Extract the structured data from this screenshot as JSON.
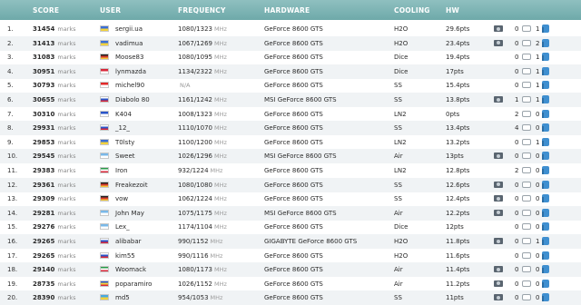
{
  "header": {
    "score": "SCORE",
    "user": "USER",
    "frequency": "FREQUENCY",
    "hardware": "HARDWARE",
    "cooling": "COOLING",
    "hw": "HW"
  },
  "rows": [
    {
      "rank": "1.",
      "score": "31454",
      "marks": "marks",
      "flag": [
        "#3b6fd6",
        "#f2d23c"
      ],
      "user": "sergii.ua",
      "freq": "1080/1323",
      "mhz": "MHz",
      "hardware": "GeForce 8600 GTS",
      "cooling": "H2O",
      "pts": "29.6pts",
      "cam": true,
      "comments": "0",
      "likes": "1"
    },
    {
      "rank": "2.",
      "score": "31413",
      "marks": "marks",
      "flag": [
        "#3b6fd6",
        "#f2d23c"
      ],
      "user": "vadimua",
      "freq": "1067/1269",
      "mhz": "MHz",
      "hardware": "GeForce 8600 GTS",
      "cooling": "H2O",
      "pts": "23.4pts",
      "cam": true,
      "comments": "0",
      "likes": "2"
    },
    {
      "rank": "3.",
      "score": "31083",
      "marks": "marks",
      "flag": [
        "#222222",
        "#d83a2c",
        "#f2c73c"
      ],
      "user": "Moose83",
      "freq": "1080/1095",
      "mhz": "MHz",
      "hardware": "GeForce 8600 GTS",
      "cooling": "Dice",
      "pts": "19.4pts",
      "cam": false,
      "comments": "0",
      "likes": "1"
    },
    {
      "rank": "4.",
      "score": "30951",
      "marks": "marks",
      "flag": [
        "#d8283a",
        "#ffffff"
      ],
      "user": "lynmazda",
      "freq": "1134/2322",
      "mhz": "MHz",
      "hardware": "GeForce 8600 GTS",
      "cooling": "Dice",
      "pts": "17pts",
      "cam": false,
      "comments": "0",
      "likes": "1"
    },
    {
      "rank": "5.",
      "score": "30793",
      "marks": "marks",
      "flag": [
        "#e02a2a",
        "#ffffff"
      ],
      "user": "michel90",
      "freq": "",
      "mhz": "N/A",
      "hardware": "GeForce 8600 GTS",
      "cooling": "SS",
      "pts": "15.4pts",
      "cam": false,
      "comments": "0",
      "likes": "1"
    },
    {
      "rank": "6.",
      "score": "30655",
      "marks": "marks",
      "flag": [
        "#ffffff",
        "#2a55c8",
        "#d8283a"
      ],
      "user": "Diabolo 80",
      "freq": "1161/1242",
      "mhz": "MHz",
      "hardware": "MSI GeForce 8600 GTS",
      "cooling": "SS",
      "pts": "13.8pts",
      "cam": true,
      "comments": "1",
      "likes": "1"
    },
    {
      "rank": "7.",
      "score": "30310",
      "marks": "marks",
      "flag": [
        "#2a55c8",
        "#ffffff"
      ],
      "user": "K404",
      "freq": "1008/1323",
      "mhz": "MHz",
      "hardware": "GeForce 8600 GTS",
      "cooling": "LN2",
      "pts": "0pts",
      "cam": false,
      "comments": "2",
      "likes": "0"
    },
    {
      "rank": "8.",
      "score": "29931",
      "marks": "marks",
      "flag": [
        "#ffffff",
        "#2a55c8",
        "#d8283a"
      ],
      "user": "_12_",
      "freq": "1110/1070",
      "mhz": "MHz",
      "hardware": "GeForce 8600 GTS",
      "cooling": "SS",
      "pts": "13.4pts",
      "cam": false,
      "comments": "4",
      "likes": "0"
    },
    {
      "rank": "9.",
      "score": "29853",
      "marks": "marks",
      "flag": [
        "#3b6fd6",
        "#f2d23c"
      ],
      "user": "T0lsty",
      "freq": "1100/1200",
      "mhz": "MHz",
      "hardware": "GeForce 8600 GTS",
      "cooling": "LN2",
      "pts": "13.2pts",
      "cam": false,
      "comments": "0",
      "likes": "1"
    },
    {
      "rank": "10.",
      "score": "29545",
      "marks": "marks",
      "flag": [
        "#7ab8e8",
        "#ffffff"
      ],
      "user": "Sweet",
      "freq": "1026/1296",
      "mhz": "MHz",
      "hardware": "MSI GeForce 8600 GTS",
      "cooling": "Air",
      "pts": "13pts",
      "cam": true,
      "comments": "0",
      "likes": "0"
    },
    {
      "rank": "11.",
      "score": "29383",
      "marks": "marks",
      "flag": [
        "#2a9a48",
        "#ffffff",
        "#d8283a"
      ],
      "user": "Iron",
      "freq": "932/1224",
      "mhz": "MHz",
      "hardware": "GeForce 8600 GTS",
      "cooling": "LN2",
      "pts": "12.8pts",
      "cam": false,
      "comments": "2",
      "likes": "0"
    },
    {
      "rank": "12.",
      "score": "29361",
      "marks": "marks",
      "flag": [
        "#222222",
        "#d83a2c",
        "#f2c73c"
      ],
      "user": "Freakezoit",
      "freq": "1080/1080",
      "mhz": "MHz",
      "hardware": "GeForce 8600 GTS",
      "cooling": "SS",
      "pts": "12.6pts",
      "cam": true,
      "comments": "0",
      "likes": "0"
    },
    {
      "rank": "13.",
      "score": "29309",
      "marks": "marks",
      "flag": [
        "#222222",
        "#d83a2c",
        "#f2c73c"
      ],
      "user": "vow",
      "freq": "1062/1224",
      "mhz": "MHz",
      "hardware": "GeForce 8600 GTS",
      "cooling": "SS",
      "pts": "12.4pts",
      "cam": true,
      "comments": "0",
      "likes": "0"
    },
    {
      "rank": "14.",
      "score": "29281",
      "marks": "marks",
      "flag": [
        "#7ab8e8",
        "#ffffff"
      ],
      "user": "John May",
      "freq": "1075/1175",
      "mhz": "MHz",
      "hardware": "MSI GeForce 8600 GTS",
      "cooling": "Air",
      "pts": "12.2pts",
      "cam": true,
      "comments": "0",
      "likes": "0"
    },
    {
      "rank": "15.",
      "score": "29276",
      "marks": "marks",
      "flag": [
        "#7ab8e8",
        "#ffffff"
      ],
      "user": "Lex_",
      "freq": "1174/1104",
      "mhz": "MHz",
      "hardware": "GeForce 8600 GTS",
      "cooling": "Dice",
      "pts": "12pts",
      "cam": false,
      "comments": "0",
      "likes": "0"
    },
    {
      "rank": "16.",
      "score": "29265",
      "marks": "marks",
      "flag": [
        "#ffffff",
        "#2a55c8",
        "#d8283a"
      ],
      "user": "alibabar",
      "freq": "990/1152",
      "mhz": "MHz",
      "hardware": "GIGABYTE GeForce 8600 GTS",
      "cooling": "H2O",
      "pts": "11.8pts",
      "cam": true,
      "comments": "0",
      "likes": "1"
    },
    {
      "rank": "17.",
      "score": "29265",
      "marks": "marks",
      "flag": [
        "#ffffff",
        "#2a55c8",
        "#d8283a"
      ],
      "user": "kim55",
      "freq": "990/1116",
      "mhz": "MHz",
      "hardware": "GeForce 8600 GTS",
      "cooling": "H2O",
      "pts": "11.6pts",
      "cam": false,
      "comments": "0",
      "likes": "0"
    },
    {
      "rank": "18.",
      "score": "29140",
      "marks": "marks",
      "flag": [
        "#2a9a48",
        "#ffffff",
        "#d8283a"
      ],
      "user": "Woomack",
      "freq": "1080/1173",
      "mhz": "MHz",
      "hardware": "GeForce 8600 GTS",
      "cooling": "Air",
      "pts": "11.4pts",
      "cam": true,
      "comments": "0",
      "likes": "0"
    },
    {
      "rank": "19.",
      "score": "28735",
      "marks": "marks",
      "flag": [
        "#2a55c8",
        "#f2d23c",
        "#d8283a"
      ],
      "user": "poparamiro",
      "freq": "1026/1152",
      "mhz": "MHz",
      "hardware": "GeForce 8600 GTS",
      "cooling": "Air",
      "pts": "11.2pts",
      "cam": true,
      "comments": "0",
      "likes": "0"
    },
    {
      "rank": "20.",
      "score": "28390",
      "marks": "marks",
      "flag": [
        "#4aa8e0",
        "#f2d23c"
      ],
      "user": "md5",
      "freq": "954/1053",
      "mhz": "MHz",
      "hardware": "GeForce 8600 GTS",
      "cooling": "SS",
      "pts": "11pts",
      "cam": true,
      "comments": "0",
      "likes": "0"
    }
  ]
}
